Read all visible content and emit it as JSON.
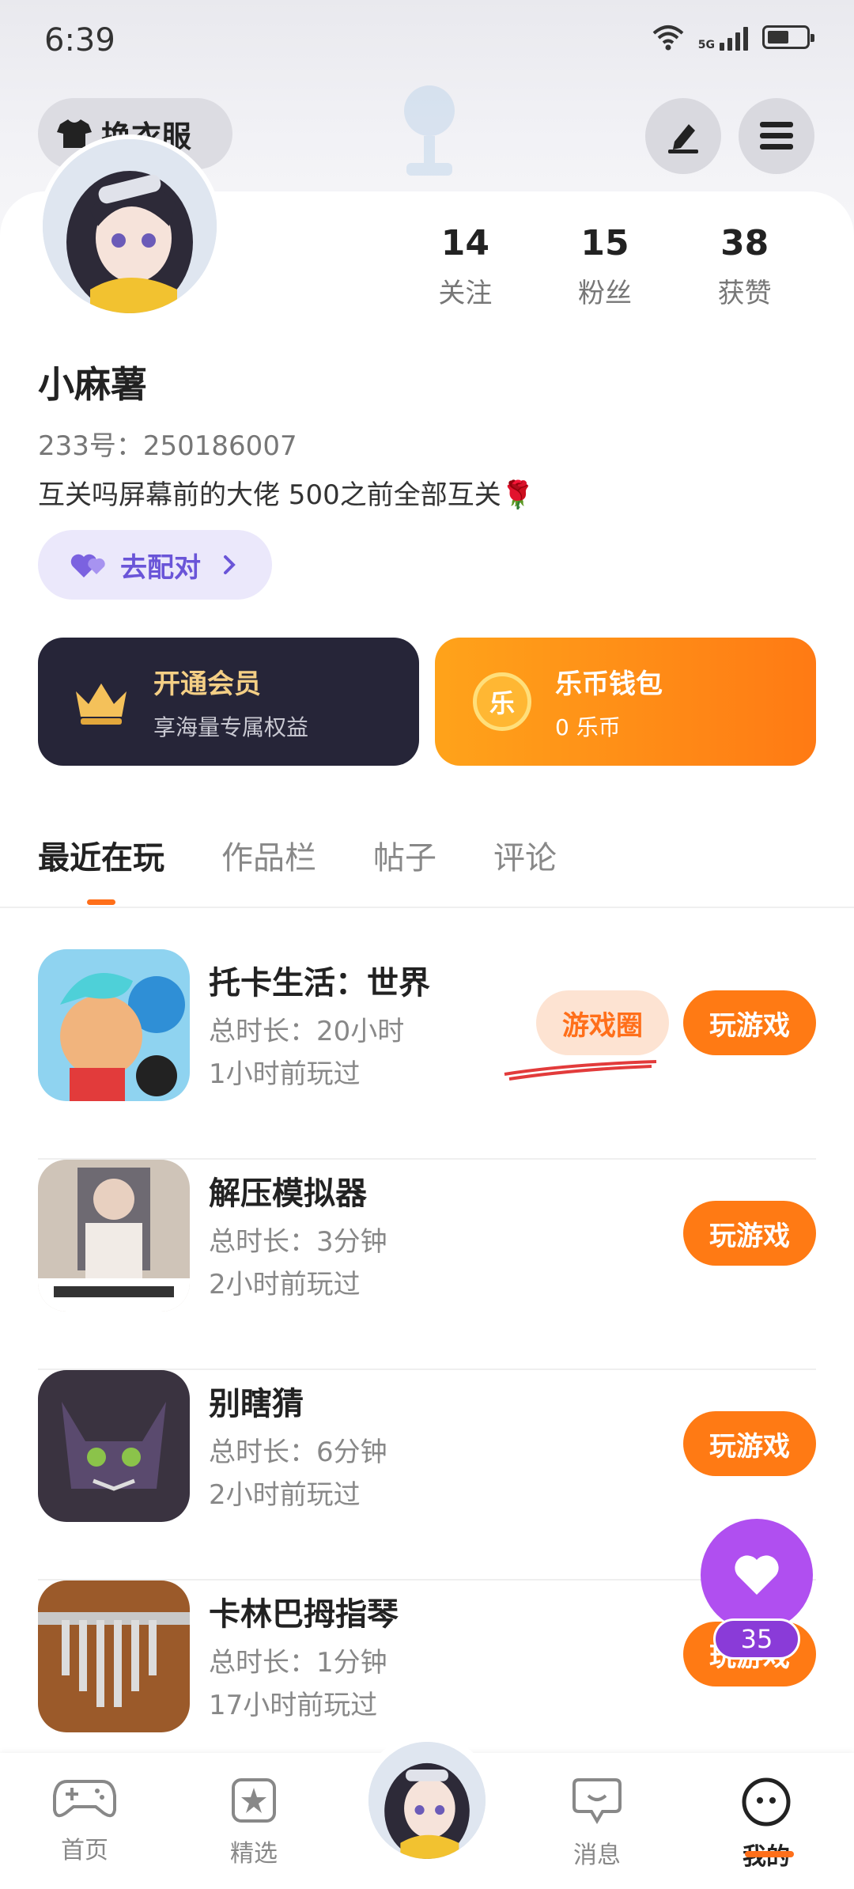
{
  "status_bar": {
    "time": "6:39",
    "network": "5G"
  },
  "header": {
    "outfit_label": "换衣服"
  },
  "profile": {
    "stats": [
      {
        "num": "14",
        "label": "关注"
      },
      {
        "num": "15",
        "label": "粉丝"
      },
      {
        "num": "38",
        "label": "获赞"
      }
    ],
    "username": "小麻薯",
    "uid": "233号：250186007",
    "bio": "互关吗屏幕前的大佬 500之前全部互关🌹",
    "match_label": "去配对"
  },
  "cards": {
    "vip": {
      "title": "开通会员",
      "subtitle": "享海量专属权益"
    },
    "wallet": {
      "coin_char": "乐",
      "title": "乐币钱包",
      "subtitle": "0 乐币"
    }
  },
  "tabs": [
    "最近在玩",
    "作品栏",
    "帖子",
    "评论"
  ],
  "games": [
    {
      "name": "托卡生活：世界",
      "duration": "总时长：20小时",
      "last": "1小时前玩过",
      "circle": "游戏圈",
      "play": "玩游戏"
    },
    {
      "name": "解压模拟器",
      "duration": "总时长：3分钟",
      "last": "2小时前玩过",
      "play": "玩游戏"
    },
    {
      "name": "别瞎猜",
      "duration": "总时长：6分钟",
      "last": "2小时前玩过",
      "play": "玩游戏"
    },
    {
      "name": "卡林巴拇指琴",
      "duration": "总时长：1分钟",
      "last": "17小时前玩过",
      "play": "玩游戏"
    }
  ],
  "fab": {
    "count": "35"
  },
  "nav": [
    {
      "label": "首页",
      "icon": "gamepad-icon"
    },
    {
      "label": "精选",
      "icon": "star-icon"
    },
    {
      "label": "",
      "icon": "avatar-center"
    },
    {
      "label": "消息",
      "icon": "message-icon"
    },
    {
      "label": "我的",
      "icon": "profile-icon"
    }
  ],
  "colors": {
    "accent": "#ff7a14",
    "purple": "#b04ff0",
    "vip_bg": "#262538"
  }
}
